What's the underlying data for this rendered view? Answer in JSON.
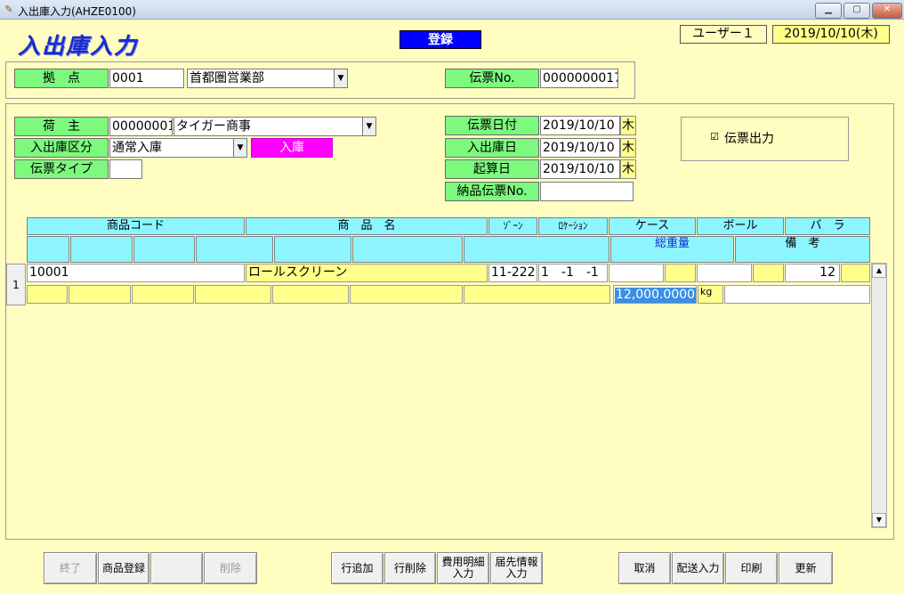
{
  "window": {
    "title": "入出庫入力(AHZE0100)"
  },
  "header": {
    "page_title": "入出庫入力",
    "mode": "登録",
    "user": "ユーザー１",
    "date": "2019/10/10(木)"
  },
  "top": {
    "base_label": "拠　点",
    "base_code": "0001",
    "base_name": "首都圏営業部",
    "slip_no_label": "伝票No.",
    "slip_no": "0000000017"
  },
  "form": {
    "shipper_label": "荷　主",
    "shipper_code": "00000001",
    "shipper_name": "タイガー商事",
    "io_type_label": "入出庫区分",
    "io_type": "通常入庫",
    "io_badge": "入庫",
    "slip_type_label": "伝票タイプ",
    "slip_type": "",
    "slip_date_label": "伝票日付",
    "slip_date": "2019/10/10",
    "slip_date_dow": "木",
    "io_date_label": "入出庫日",
    "io_date": "2019/10/10",
    "io_date_dow": "木",
    "calc_date_label": "起算日",
    "calc_date": "2019/10/10",
    "calc_date_dow": "木",
    "delivery_no_label": "納品伝票No.",
    "delivery_no": "",
    "print_label": "伝票出力",
    "print_checked": true
  },
  "grid": {
    "headers": [
      "商品コード",
      "商　品　名",
      "ｿﾞｰﾝ",
      "ﾛｹｰｼｮﾝ",
      "ケース",
      "ボール",
      "バ　ラ"
    ],
    "headers2": [
      "総重量",
      "備　考"
    ],
    "rows": [
      {
        "num": "1",
        "code": "10001",
        "name": "ロールスクリーン",
        "zone": "11-222",
        "location": "1　-1　-1",
        "bara": "12",
        "weight": "12,000.0000",
        "weight_unit": "kg"
      }
    ]
  },
  "buttons": {
    "exit": "終了",
    "item_reg": "商品登録",
    "blank": "",
    "delete": "削除",
    "add_row": "行追加",
    "del_row": "行削除",
    "cost_detail": "費用明細\n入力",
    "dest_info": "届先情報\n入力",
    "cancel": "取消",
    "delivery": "配送入力",
    "print": "印刷",
    "update": "更新"
  },
  "colors": {
    "label_green": "#7dfa7d",
    "header_cyan": "#8cf5ff",
    "badge_magenta": "#ff00ff",
    "mode_blue": "#0000ff",
    "bg": "#fffdc0"
  }
}
